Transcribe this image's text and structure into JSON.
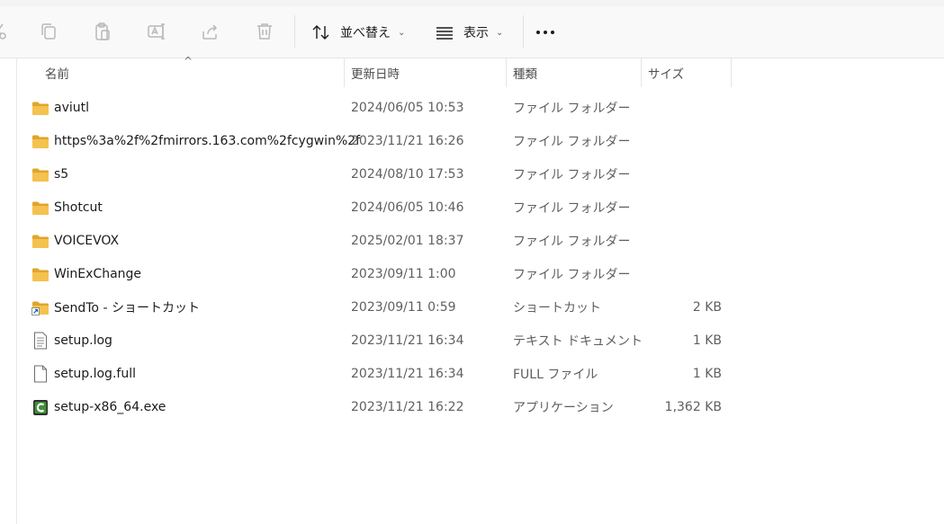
{
  "toolbar": {
    "icons": [
      "cut-icon",
      "copy-icon",
      "paste-icon",
      "rename-icon",
      "share-icon",
      "delete-icon"
    ],
    "sort_label": "並べ替え",
    "view_label": "表示",
    "more_icon": "more-options-icon"
  },
  "columns": {
    "name": "名前",
    "date": "更新日時",
    "type": "種類",
    "size": "サイズ"
  },
  "sort": {
    "column": "name",
    "direction": "ascending"
  },
  "files": [
    {
      "name": "aviutl",
      "date": "2024/06/05 10:53",
      "type": "ファイル フォルダー",
      "size": "",
      "icon": "folder-icon"
    },
    {
      "name": "https%3a%2f%2fmirrors.163.com%2fcygwin%2f",
      "date": "2023/11/21 16:26",
      "type": "ファイル フォルダー",
      "size": "",
      "icon": "folder-icon"
    },
    {
      "name": "s5",
      "date": "2024/08/10 17:53",
      "type": "ファイル フォルダー",
      "size": "",
      "icon": "folder-icon"
    },
    {
      "name": "Shotcut",
      "date": "2024/06/05 10:46",
      "type": "ファイル フォルダー",
      "size": "",
      "icon": "folder-icon"
    },
    {
      "name": "VOICEVOX",
      "date": "2025/02/01 18:37",
      "type": "ファイル フォルダー",
      "size": "",
      "icon": "folder-icon"
    },
    {
      "name": "WinExChange",
      "date": "2023/09/11 1:00",
      "type": "ファイル フォルダー",
      "size": "",
      "icon": "folder-icon"
    },
    {
      "name": "SendTo - ショートカット",
      "date": "2023/09/11 0:59",
      "type": "ショートカット",
      "size": "2 KB",
      "icon": "folder-shortcut-icon"
    },
    {
      "name": "setup.log",
      "date": "2023/11/21 16:34",
      "type": "テキスト ドキュメント",
      "size": "1 KB",
      "icon": "text-document-icon"
    },
    {
      "name": "setup.log.full",
      "date": "2023/11/21 16:34",
      "type": "FULL ファイル",
      "size": "1 KB",
      "icon": "blank-file-icon"
    },
    {
      "name": "setup-x86_64.exe",
      "date": "2023/11/21 16:22",
      "type": "アプリケーション",
      "size": "1,362 KB",
      "icon": "cygwin-app-icon"
    }
  ],
  "colors": {
    "folder": "#f4c24e",
    "folder_dark": "#e0a52b",
    "accent": "#0067c0"
  }
}
